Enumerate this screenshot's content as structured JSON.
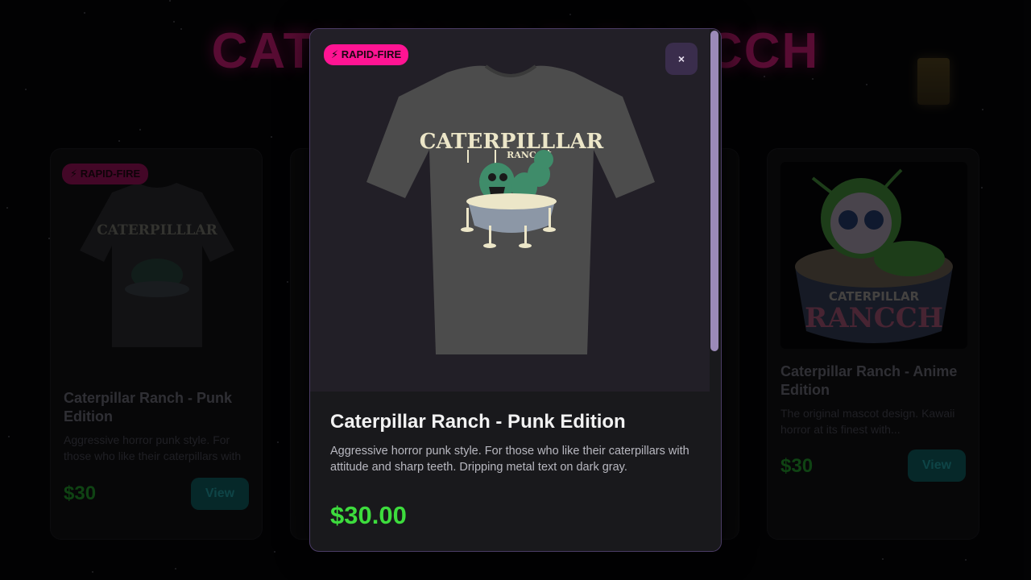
{
  "page": {
    "title": "CATERPILLAR RANCCH"
  },
  "cards": [
    {
      "badge": "⚡ RAPID-FIRE",
      "title": "Caterpillar Ranch - Punk Edition",
      "description": "Aggressive horror punk style. For those who like their caterpillars with attitude and sharp teeth.",
      "price": "$30",
      "button": "View"
    },
    {
      "title": "Caterpillar Ranch - Anime Edition",
      "description": "The original mascot design. Kawaii horror at its finest with...",
      "price": "$30",
      "button": "View",
      "image_text_top": "CATERPILLAR",
      "image_text_bottom": "RANCCH"
    }
  ],
  "modal": {
    "badge": "⚡ RAPID-FIRE",
    "close_label": "×",
    "shirt_text": "CATERPILLLAR",
    "shirt_subtext": "RANCCH",
    "title": "Caterpillar Ranch - Punk Edition",
    "description": "Aggressive horror punk style. For those who like their caterpillars with attitude and sharp teeth. Dripping metal text on dark gray.",
    "price": "$30.00"
  },
  "colors": {
    "accent_pink": "#ff1493",
    "price_green": "#3ddc3d",
    "view_teal": "#0b4a4c",
    "modal_border": "#4b3c66",
    "scroll_thumb": "#9b8ab8"
  }
}
